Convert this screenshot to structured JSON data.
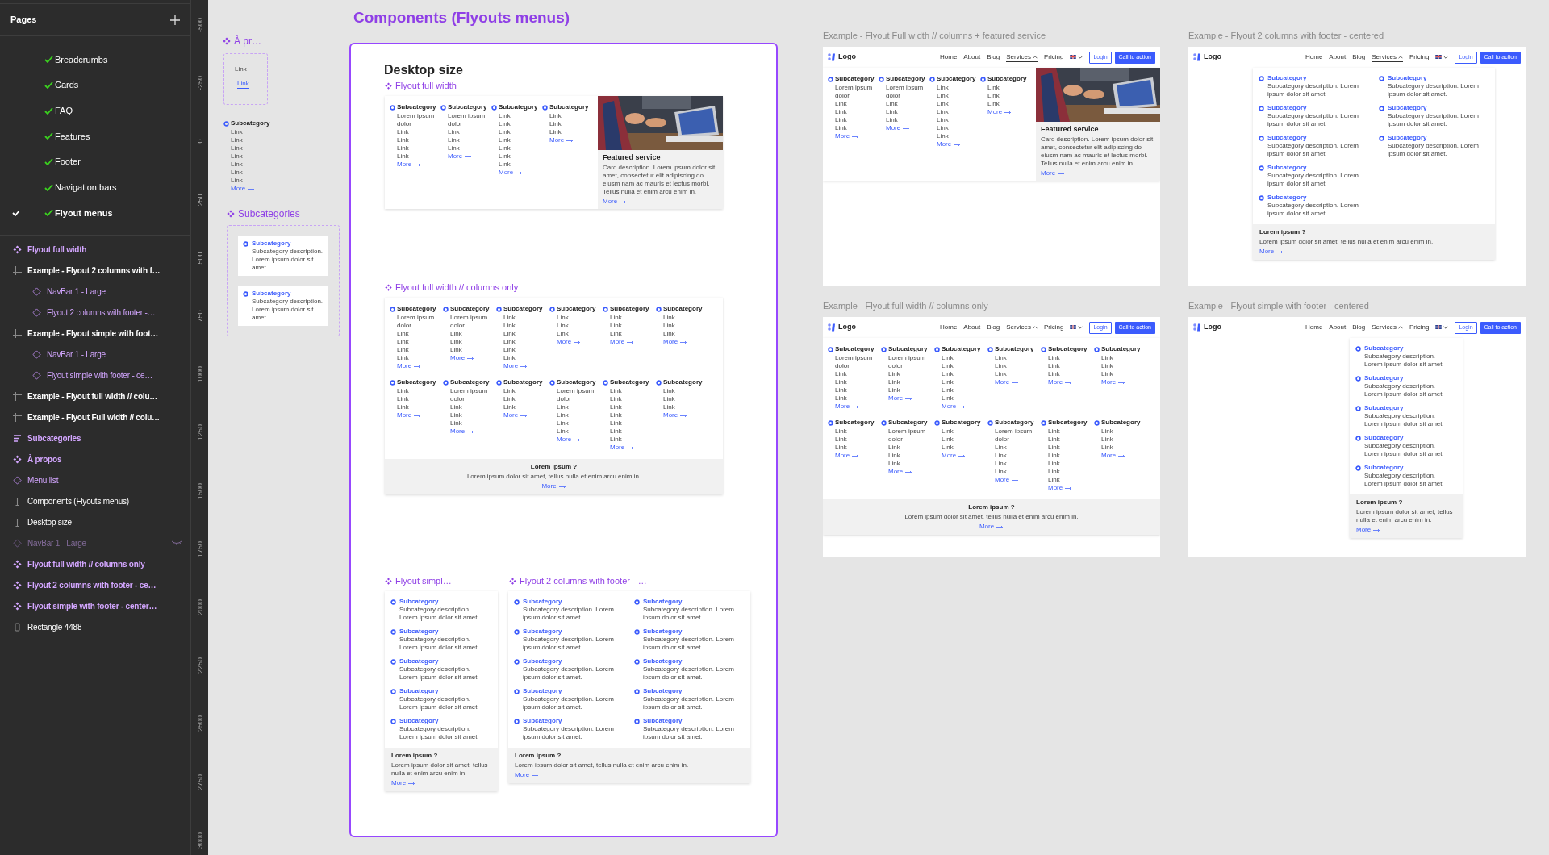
{
  "sidebar": {
    "pages_title": "Pages",
    "pages": [
      {
        "name": "Breadcrumbs",
        "selected": false
      },
      {
        "name": "Cards",
        "selected": false
      },
      {
        "name": "FAQ",
        "selected": false
      },
      {
        "name": "Features",
        "selected": false
      },
      {
        "name": "Footer",
        "selected": false
      },
      {
        "name": "Navigation bars",
        "selected": false
      },
      {
        "name": "Flyout menus",
        "selected": true
      }
    ],
    "layers": [
      {
        "name": "Flyout full width",
        "kind": "component_set",
        "hidden": false
      },
      {
        "name": "Example - Flyout 2 columns with f…",
        "kind": "frame",
        "hidden": false,
        "children": [
          {
            "name": "NavBar 1 - Large",
            "kind": "instance",
            "hidden": false
          },
          {
            "name": "Flyout 2 columns with footer -…",
            "kind": "instance",
            "hidden": false
          }
        ]
      },
      {
        "name": "Example - Flyout simple with foot…",
        "kind": "frame",
        "hidden": false,
        "children": [
          {
            "name": "NavBar 1 - Large",
            "kind": "instance",
            "hidden": false
          },
          {
            "name": "Flyout simple with footer - ce…",
            "kind": "instance",
            "hidden": false
          }
        ]
      },
      {
        "name": "Example - Flyout full width // colu…",
        "kind": "frame",
        "hidden": false
      },
      {
        "name": "Example - Flyout Full width // colu…",
        "kind": "frame",
        "hidden": false
      },
      {
        "name": "Subcategories",
        "kind": "auto_layout",
        "hidden": false
      },
      {
        "name": "À propos",
        "kind": "component_set",
        "hidden": false
      },
      {
        "name": "Menu list",
        "kind": "instance",
        "hidden": false
      },
      {
        "name": "Components (Flyouts menus)",
        "kind": "text",
        "hidden": false
      },
      {
        "name": "Desktop size",
        "kind": "text",
        "hidden": false
      },
      {
        "name": "NavBar 1 - Large",
        "kind": "instance",
        "hidden": true
      },
      {
        "name": "Flyout full width // columns only",
        "kind": "component_set",
        "hidden": false
      },
      {
        "name": "Flyout 2 columns with footer - ce…",
        "kind": "component_set",
        "hidden": false
      },
      {
        "name": "Flyout simple with footer - center…",
        "kind": "component_set",
        "hidden": false
      },
      {
        "name": "Rectangle 4488",
        "kind": "rectangle",
        "hidden": false
      }
    ]
  },
  "ruler": {
    "labels": [
      "-500",
      "-250",
      "0",
      "250",
      "500",
      "750",
      "1000",
      "1250",
      "1500",
      "1750",
      "2000",
      "2250",
      "2500",
      "2750",
      "3000"
    ]
  },
  "canvas": {
    "a_propos": {
      "label": "À pr…",
      "links": [
        {
          "label": "Link",
          "selected": false
        },
        {
          "label": "Link",
          "selected": true
        }
      ]
    },
    "menu_list": {
      "title": "Subcategory",
      "links": [
        "Link",
        "Link",
        "Link",
        "Link",
        "Link",
        "Link",
        "Link"
      ],
      "more": "More"
    },
    "subcategories": {
      "label": "Subcategories",
      "items": [
        {
          "title": "Subcategory",
          "description": "Subcategory description. Lorem ipsum dolor sit amet."
        },
        {
          "title": "Subcategory",
          "description": "Subcategory description. Lorem ipsum dolor sit amet."
        }
      ]
    },
    "components_frame": {
      "title": "Components (Flyouts menus)",
      "heading": "Desktop size",
      "sections": [
        {
          "label": "Flyout full width",
          "flyout": {
            "kind": "columns_featured",
            "rows": [
              [
                {
                  "title": "Subcategory",
                  "links": [
                    "Lorem ipsum dolor",
                    "Link",
                    "Link",
                    "Link",
                    "Link"
                  ],
                  "more": "More"
                },
                {
                  "title": "Subcategory",
                  "links": [
                    "Lorem ipsum dolor",
                    "Link",
                    "Link",
                    "Link"
                  ],
                  "more": "More"
                },
                {
                  "title": "Subcategory",
                  "links": [
                    "Link",
                    "Link",
                    "Link",
                    "Link",
                    "Link",
                    "Link",
                    "Link"
                  ],
                  "more": "More"
                },
                {
                  "title": "Subcategory",
                  "links": [
                    "Link",
                    "Link",
                    "Link"
                  ],
                  "more": "More"
                }
              ]
            ],
            "featured": {
              "title": "Featured service",
              "description": "Card description. Lorem ipsum dolor sit amet, consectetur elit adipiscing do eiusm nam ac mauris et lectus morbi. Tellus nulla et enim arcu enim in.",
              "more": "More"
            }
          }
        },
        {
          "label": "Flyout full width // columns only",
          "flyout": {
            "kind": "columns",
            "rows": [
              [
                {
                  "title": "Subcategory",
                  "links": [
                    "Lorem ipsum dolor",
                    "Link",
                    "Link",
                    "Link",
                    "Link"
                  ],
                  "more": "More"
                },
                {
                  "title": "Subcategory",
                  "links": [
                    "Lorem ipsum dolor",
                    "Link",
                    "Link",
                    "Link"
                  ],
                  "more": "More"
                },
                {
                  "title": "Subcategory",
                  "links": [
                    "Link",
                    "Link",
                    "Link",
                    "Link",
                    "Link",
                    "Link"
                  ],
                  "more": "More"
                },
                {
                  "title": "Subcategory",
                  "links": [
                    "Link",
                    "Link",
                    "Link"
                  ],
                  "more": "More"
                },
                {
                  "title": "Subcategory",
                  "links": [
                    "Link",
                    "Link",
                    "Link"
                  ],
                  "more": "More"
                },
                {
                  "title": "Subcategory",
                  "links": [
                    "Link",
                    "Link",
                    "Link"
                  ],
                  "more": "More"
                }
              ],
              [
                {
                  "title": "Subcategory",
                  "links": [
                    "Link",
                    "Link",
                    "Link"
                  ],
                  "more": "More"
                },
                {
                  "title": "Subcategory",
                  "links": [
                    "Lorem ipsum dolor",
                    "Link",
                    "Link",
                    "Link"
                  ],
                  "more": "More"
                },
                {
                  "title": "Subcategory",
                  "links": [
                    "Link",
                    "Link",
                    "Link"
                  ],
                  "more": "More"
                },
                {
                  "title": "Subcategory",
                  "links": [
                    "Lorem ipsum dolor",
                    "Link",
                    "Link",
                    "Link",
                    "Link"
                  ],
                  "more": "More"
                },
                {
                  "title": "Subcategory",
                  "links": [
                    "Link",
                    "Link",
                    "Link",
                    "Link",
                    "Link",
                    "Link",
                    "Link"
                  ],
                  "more": "More"
                },
                {
                  "title": "Subcategory",
                  "links": [
                    "Link",
                    "Link",
                    "Link"
                  ],
                  "more": "More"
                }
              ]
            ],
            "footer": {
              "title": "Lorem ipsum ?",
              "text": "Lorem ipsum dolor sit amet, tellus nulla et enim arcu enim in.",
              "more": "More"
            }
          }
        },
        {
          "label": "Flyout simpl…",
          "flyout": {
            "kind": "list",
            "item_columns": [
              [
                {
                  "title": "Subcategory",
                  "description": "Subcategory description. Lorem ipsum dolor sit amet."
                },
                {
                  "title": "Subcategory",
                  "description": "Subcategory description. Lorem ipsum dolor sit amet."
                },
                {
                  "title": "Subcategory",
                  "description": "Subcategory description. Lorem ipsum dolor sit amet."
                },
                {
                  "title": "Subcategory",
                  "description": "Subcategory description. Lorem ipsum dolor sit amet."
                },
                {
                  "title": "Subcategory",
                  "description": "Subcategory description. Lorem ipsum dolor sit amet."
                }
              ]
            ],
            "footer": {
              "title": "Lorem ipsum ?",
              "text": "Lorem ipsum dolor sit amet, tellus nulla et enim arcu enim in.",
              "more": "More"
            }
          }
        },
        {
          "label": "Flyout 2 columns with footer - …",
          "flyout": {
            "kind": "list",
            "item_columns": [
              [
                {
                  "title": "Subcategory",
                  "description": "Subcategory description. Lorem ipsum dolor sit amet."
                },
                {
                  "title": "Subcategory",
                  "description": "Subcategory description. Lorem ipsum dolor sit amet."
                },
                {
                  "title": "Subcategory",
                  "description": "Subcategory description. Lorem ipsum dolor sit amet."
                },
                {
                  "title": "Subcategory",
                  "description": "Subcategory description. Lorem ipsum dolor sit amet."
                },
                {
                  "title": "Subcategory",
                  "description": "Subcategory description. Lorem ipsum dolor sit amet."
                }
              ],
              [
                {
                  "title": "Subcategory",
                  "description": "Subcategory description. Lorem ipsum dolor sit amet."
                },
                {
                  "title": "Subcategory",
                  "description": "Subcategory description. Lorem ipsum dolor sit amet."
                },
                {
                  "title": "Subcategory",
                  "description": "Subcategory description. Lorem ipsum dolor sit amet."
                },
                {
                  "title": "Subcategory",
                  "description": "Subcategory description. Lorem ipsum dolor sit amet."
                },
                {
                  "title": "Subcategory",
                  "description": "Subcategory description. Lorem ipsum dolor sit amet."
                }
              ]
            ],
            "footer": {
              "title": "Lorem ipsum ?",
              "text": "Lorem ipsum dolor sit amet, tellus nulla et enim arcu enim in.",
              "more": "More"
            }
          }
        }
      ]
    },
    "examples": [
      {
        "title": "Example - Flyout Full width // columns + featured service",
        "navbar": {
          "logo": "Logo",
          "items": [
            {
              "label": "Home",
              "kind": "link",
              "selected": false
            },
            {
              "label": "About",
              "kind": "link",
              "selected": false
            },
            {
              "label": "Blog",
              "kind": "link",
              "selected": false
            },
            {
              "label": "Services",
              "kind": "dropdown",
              "selected": true,
              "expanded": true
            },
            {
              "label": "Pricing",
              "kind": "link",
              "selected": false
            },
            {
              "kind": "language",
              "selected": false,
              "expanded": false
            }
          ],
          "login": "Login",
          "cta": "Call to action"
        },
        "flyout": {
          "kind": "columns_featured",
          "rows": [
            [
              {
                "title": "Subcategory",
                "links": [
                  "Lorem ipsum dolor",
                  "Link",
                  "Link",
                  "Link",
                  "Link"
                ],
                "more": "More"
              },
              {
                "title": "Subcategory",
                "links": [
                  "Lorem ipsum dolor",
                  "Link",
                  "Link",
                  "Link"
                ],
                "more": "More"
              },
              {
                "title": "Subcategory",
                "links": [
                  "Link",
                  "Link",
                  "Link",
                  "Link",
                  "Link",
                  "Link",
                  "Link"
                ],
                "more": "More"
              },
              {
                "title": "Subcategory",
                "links": [
                  "Link",
                  "Link",
                  "Link"
                ],
                "more": "More"
              }
            ]
          ],
          "featured": {
            "title": "Featured service",
            "description": "Card description. Lorem ipsum dolor sit amet, consectetur elit adipiscing do eiusm nam ac mauris et lectus morbi. Tellus nulla et enim arcu enim in.",
            "more": "More"
          }
        }
      },
      {
        "title": "Example - Flyout 2 columns with footer - centered",
        "navbar": {
          "logo": "Logo",
          "items": [
            {
              "label": "Home",
              "kind": "link",
              "selected": false
            },
            {
              "label": "About",
              "kind": "link",
              "selected": false
            },
            {
              "label": "Blog",
              "kind": "link",
              "selected": false
            },
            {
              "label": "Services",
              "kind": "dropdown",
              "selected": true,
              "expanded": true
            },
            {
              "label": "Pricing",
              "kind": "link",
              "selected": false
            },
            {
              "kind": "language",
              "selected": false,
              "expanded": false
            }
          ],
          "login": "Login",
          "cta": "Call to action"
        },
        "flyout": {
          "kind": "list",
          "item_columns": [
            [
              {
                "title": "Subcategory",
                "description": "Subcategory description. Lorem ipsum dolor sit amet."
              },
              {
                "title": "Subcategory",
                "description": "Subcategory description. Lorem ipsum dolor sit amet."
              },
              {
                "title": "Subcategory",
                "description": "Subcategory description. Lorem ipsum dolor sit amet."
              },
              {
                "title": "Subcategory",
                "description": "Subcategory description. Lorem ipsum dolor sit amet."
              },
              {
                "title": "Subcategory",
                "description": "Subcategory description. Lorem ipsum dolor sit amet."
              }
            ],
            [
              {
                "title": "Subcategory",
                "description": "Subcategory description. Lorem ipsum dolor sit amet."
              },
              {
                "title": "Subcategory",
                "description": "Subcategory description. Lorem ipsum dolor sit amet."
              },
              {
                "title": "Subcategory",
                "description": "Subcategory description. Lorem ipsum dolor sit amet."
              }
            ]
          ],
          "footer": {
            "title": "Lorem ipsum ?",
            "text": "Lorem ipsum dolor sit amet, tellus nulla et enim arcu enim in.",
            "more": "More"
          }
        }
      },
      {
        "title": "Example - Flyout full width // columns only",
        "navbar": {
          "logo": "Logo",
          "items": [
            {
              "label": "Home",
              "kind": "link",
              "selected": false
            },
            {
              "label": "About",
              "kind": "link",
              "selected": false
            },
            {
              "label": "Blog",
              "kind": "link",
              "selected": false
            },
            {
              "label": "Services",
              "kind": "dropdown",
              "selected": true,
              "expanded": true
            },
            {
              "label": "Pricing",
              "kind": "link",
              "selected": false
            },
            {
              "kind": "language",
              "selected": false,
              "expanded": false
            }
          ],
          "login": "Login",
          "cta": "Call to action"
        },
        "flyout": {
          "kind": "columns",
          "rows": [
            [
              {
                "title": "Subcategory",
                "links": [
                  "Lorem ipsum dolor",
                  "Link",
                  "Link",
                  "Link",
                  "Link"
                ],
                "more": "More"
              },
              {
                "title": "Subcategory",
                "links": [
                  "Lorem ipsum dolor",
                  "Link",
                  "Link",
                  "Link"
                ],
                "more": "More"
              },
              {
                "title": "Subcategory",
                "links": [
                  "Link",
                  "Link",
                  "Link",
                  "Link",
                  "Link",
                  "Link"
                ],
                "more": "More"
              },
              {
                "title": "Subcategory",
                "links": [
                  "Link",
                  "Link",
                  "Link"
                ],
                "more": "More"
              },
              {
                "title": "Subcategory",
                "links": [
                  "Link",
                  "Link",
                  "Link"
                ],
                "more": "More"
              },
              {
                "title": "Subcategory",
                "links": [
                  "Link",
                  "Link",
                  "Link"
                ],
                "more": "More"
              }
            ],
            [
              {
                "title": "Subcategory",
                "links": [
                  "Link",
                  "Link",
                  "Link"
                ],
                "more": "More"
              },
              {
                "title": "Subcategory",
                "links": [
                  "Lorem ipsum dolor",
                  "Link",
                  "Link",
                  "Link"
                ],
                "more": "More"
              },
              {
                "title": "Subcategory",
                "links": [
                  "Link",
                  "Link",
                  "Link"
                ],
                "more": "More"
              },
              {
                "title": "Subcategory",
                "links": [
                  "Lorem ipsum dolor",
                  "Link",
                  "Link",
                  "Link",
                  "Link"
                ],
                "more": "More"
              },
              {
                "title": "Subcategory",
                "links": [
                  "Link",
                  "Link",
                  "Link",
                  "Link",
                  "Link",
                  "Link",
                  "Link"
                ],
                "more": "More"
              },
              {
                "title": "Subcategory",
                "links": [
                  "Link",
                  "Link",
                  "Link"
                ],
                "more": "More"
              }
            ]
          ],
          "footer": {
            "title": "Lorem ipsum ?",
            "text": "Lorem ipsum dolor sit amet, tellus nulla et enim arcu enim in.",
            "more": "More"
          }
        }
      },
      {
        "title": "Example - Flyout simple with footer - centered",
        "navbar": {
          "logo": "Logo",
          "items": [
            {
              "label": "Home",
              "kind": "link",
              "selected": false
            },
            {
              "label": "About",
              "kind": "link",
              "selected": false
            },
            {
              "label": "Blog",
              "kind": "link",
              "selected": false
            },
            {
              "label": "Services",
              "kind": "dropdown",
              "selected": true,
              "expanded": true
            },
            {
              "label": "Pricing",
              "kind": "link",
              "selected": false
            },
            {
              "kind": "language",
              "selected": false,
              "expanded": false
            }
          ],
          "login": "Login",
          "cta": "Call to action"
        },
        "flyout": {
          "kind": "list",
          "item_columns": [
            [
              {
                "title": "Subcategory",
                "description": "Subcategory description. Lorem ipsum dolor sit amet."
              },
              {
                "title": "Subcategory",
                "description": "Subcategory description. Lorem ipsum dolor sit amet."
              },
              {
                "title": "Subcategory",
                "description": "Subcategory description. Lorem ipsum dolor sit amet."
              },
              {
                "title": "Subcategory",
                "description": "Subcategory description. Lorem ipsum dolor sit amet."
              },
              {
                "title": "Subcategory",
                "description": "Subcategory description. Lorem ipsum dolor sit amet."
              }
            ]
          ],
          "footer": {
            "title": "Lorem ipsum ?",
            "text": "Lorem ipsum dolor sit amet, tellus nulla et enim arcu enim in.",
            "more": "More"
          }
        }
      }
    ]
  }
}
